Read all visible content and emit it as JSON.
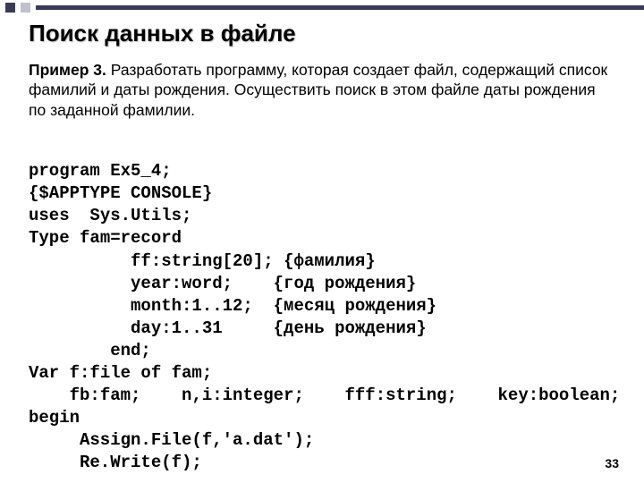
{
  "slide": {
    "title": "Поиск данных в файле",
    "example_label": "Пример 3.",
    "example_text": "Разработать программу, которая создает файл, содержащий список фамилий и даты рождения. Осуществить поиск в этом файле даты рождения по заданной фамилии.",
    "page_number": "33"
  },
  "code": {
    "l1": "program Ex5_4;",
    "l2": "{$APPTYPE CONSOLE}",
    "l3": "uses  Sys.Utils;",
    "l4": "Type fam=record",
    "l5a": "ff:string[20];",
    "l5c": "{фамилия}",
    "l6a": "year:word;",
    "l6c": "{год рождения}",
    "l7a": "month:1..12;",
    "l7c": "{месяц рождения}",
    "l8a": "day:1..31",
    "l8c": "{день рождения}",
    "l9": "end;",
    "l10": "Var f:file of fam;",
    "l11a": "fb:fam;",
    "l11b": "n,i:integer;",
    "l11c": "fff:string;",
    "l11d": "key:boolean;",
    "l12": "begin",
    "l13": "Assign.File(f,'a.dat');",
    "l14": "Re.Write(f);"
  }
}
